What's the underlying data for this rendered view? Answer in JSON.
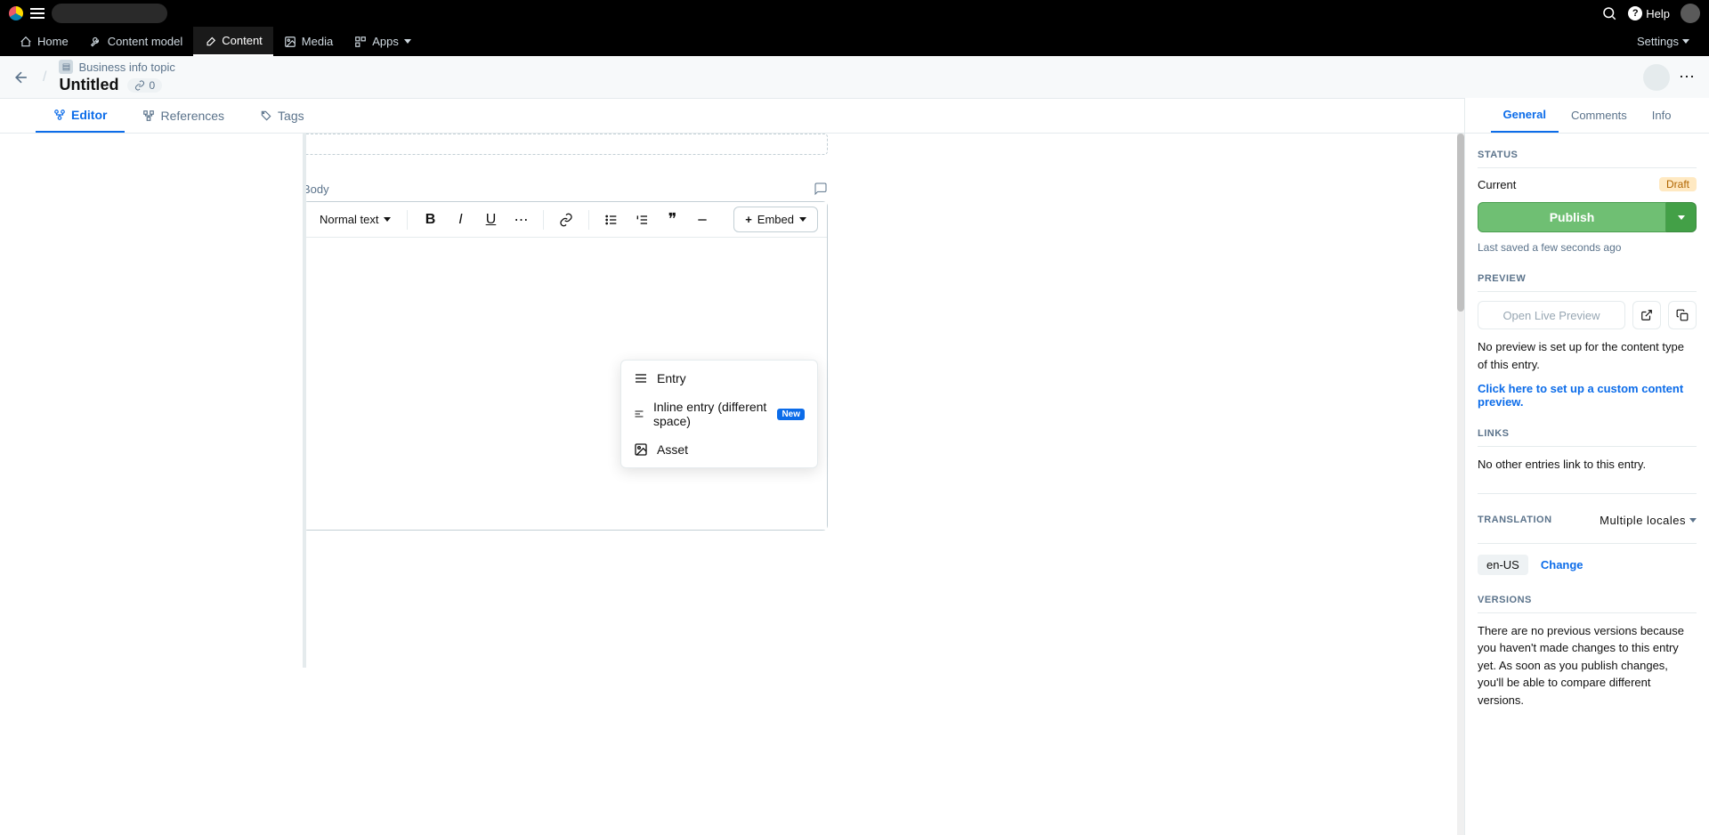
{
  "topbar": {
    "help_label": "Help"
  },
  "nav": {
    "home": "Home",
    "content_model": "Content model",
    "content": "Content",
    "media": "Media",
    "apps": "Apps",
    "settings": "Settings"
  },
  "header": {
    "breadcrumb": "Business info topic",
    "title": "Untitled",
    "link_count": "0"
  },
  "tabs": {
    "editor": "Editor",
    "references": "References",
    "tags": "Tags"
  },
  "editor": {
    "body_label": "Body",
    "text_style": "Normal text",
    "embed_label": "Embed"
  },
  "embed_menu": {
    "entry": "Entry",
    "inline": "Inline entry (different space)",
    "inline_badge": "New",
    "asset": "Asset"
  },
  "sidebar": {
    "tabs": {
      "general": "General",
      "comments": "Comments",
      "info": "Info"
    },
    "status": {
      "heading": "STATUS",
      "current_label": "Current",
      "draft_badge": "Draft",
      "publish_btn": "Publish",
      "saved_text": "Last saved a few seconds ago"
    },
    "preview": {
      "heading": "PREVIEW",
      "open_btn": "Open Live Preview",
      "no_preview": "No preview is set up for the content type of this entry.",
      "setup_link": "Click here to set up a custom content preview."
    },
    "links": {
      "heading": "LINKS",
      "none": "No other entries link to this entry."
    },
    "translation": {
      "heading": "TRANSLATION",
      "multiple": "Multiple locales",
      "locale": "en-US",
      "change": "Change"
    },
    "versions": {
      "heading": "VERSIONS",
      "none": "There are no previous versions because you haven't made changes to this entry yet. As soon as you publish changes, you'll be able to compare different versions."
    }
  }
}
